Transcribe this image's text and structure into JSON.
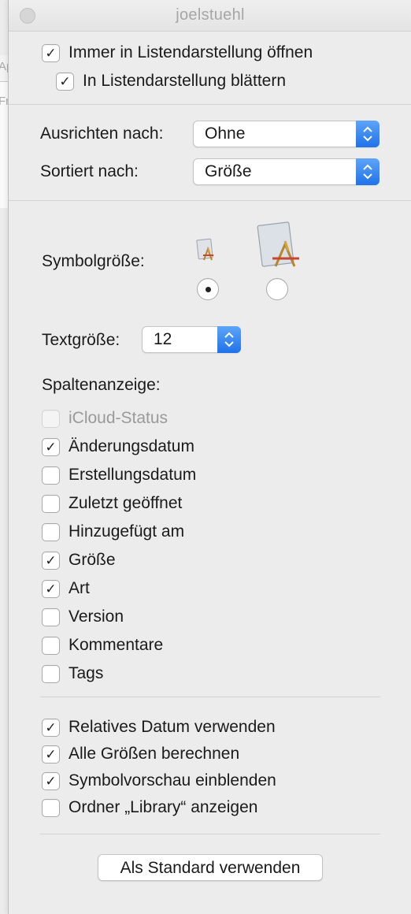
{
  "window": {
    "title": "joelstuehl"
  },
  "top_options": [
    {
      "label": "Immer in Listendarstellung öffnen",
      "checked": true
    },
    {
      "label": "In Listendarstellung blättern",
      "checked": true
    }
  ],
  "arrange": {
    "label": "Ausrichten nach:",
    "value": "Ohne"
  },
  "sort": {
    "label": "Sortiert nach:",
    "value": "Größe"
  },
  "icon_size": {
    "label": "Symbolgröße:",
    "selected": "small",
    "icon": "application-icon"
  },
  "text_size": {
    "label": "Textgröße:",
    "value": "12"
  },
  "columns": {
    "heading": "Spaltenanzeige:",
    "items": [
      {
        "label": "iCloud-Status",
        "checked": false,
        "disabled": true
      },
      {
        "label": "Änderungsdatum",
        "checked": true
      },
      {
        "label": "Erstellungsdatum",
        "checked": false
      },
      {
        "label": "Zuletzt geöffnet",
        "checked": false
      },
      {
        "label": "Hinzugefügt am",
        "checked": false
      },
      {
        "label": "Größe",
        "checked": true
      },
      {
        "label": "Art",
        "checked": true
      },
      {
        "label": "Version",
        "checked": false
      },
      {
        "label": "Kommentare",
        "checked": false
      },
      {
        "label": "Tags",
        "checked": false
      }
    ]
  },
  "bottom_options": [
    {
      "label": "Relatives Datum verwenden",
      "checked": true
    },
    {
      "label": "Alle Größen berechnen",
      "checked": true
    },
    {
      "label": "Symbolvorschau einblenden",
      "checked": true
    },
    {
      "label": "Ordner „Library“ anzeigen",
      "checked": false
    }
  ],
  "default_button": {
    "label": "Als Standard verwenden"
  },
  "background_window": {
    "chars": [
      "Ap",
      "Fr"
    ]
  },
  "colors": {
    "accent": "#2a7bef",
    "panel": "#ececec",
    "title": "#a6a6a6"
  }
}
